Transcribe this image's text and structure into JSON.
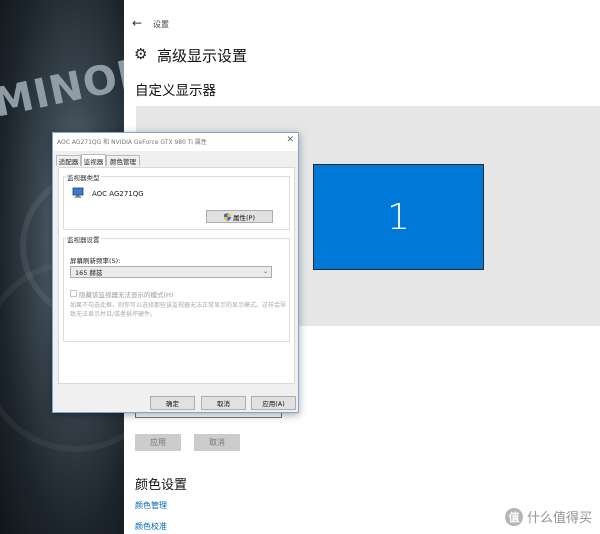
{
  "settings": {
    "window_title": "设置",
    "page_title": "高级显示设置",
    "display_heading": "自定义显示器",
    "monitor_number": "1",
    "apply_label": "应用",
    "cancel_label": "取消",
    "color_heading": "颜色设置",
    "color_management_link": "颜色管理",
    "color_calibration_link": "颜色校准"
  },
  "dialog": {
    "title": "AOC AG271QG 和 NVIDIA GeForce GTX 980 Ti 属性",
    "tabs": [
      {
        "label": "适配器",
        "active": false
      },
      {
        "label": "监视器",
        "active": true
      },
      {
        "label": "颜色管理",
        "active": false
      }
    ],
    "monitor_type_label": "监视器类型",
    "monitor_name": "AOC AG271QG",
    "properties_label": "属性(P)",
    "monitor_settings_label": "监视器设置",
    "refresh_rate_label": "屏幕刷新频率(S):",
    "refresh_rate_value": "165 赫兹",
    "hide_modes_label": "隐藏该监视器无法显示的模式(H)",
    "hide_modes_checked": false,
    "hide_modes_description": "如果不勾选此框，则你可以选择那些该监视器无法正常显示的显示模式。这样会导致无法显示并且/或者损坏硬件。",
    "ok_label": "确定",
    "cancel_label": "取消",
    "apply_label": "应用(A)"
  },
  "desktop": {
    "brand_text": "MINOLTA"
  },
  "watermark": {
    "logo_glyph": "值",
    "text": "什么值得买"
  },
  "colors": {
    "accent": "#0078d7",
    "link": "#0066b4",
    "dialog_bg": "#f0f0f0",
    "display_area": "#e6e6e6"
  }
}
